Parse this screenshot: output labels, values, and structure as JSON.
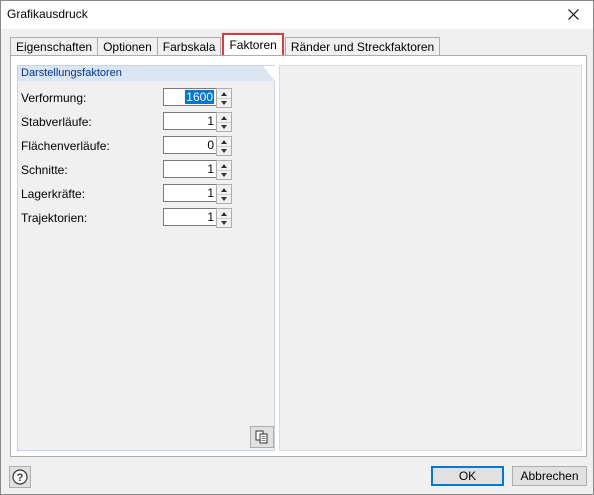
{
  "window": {
    "title": "Grafikausdruck"
  },
  "tabs": [
    {
      "label": "Eigenschaften",
      "active": false
    },
    {
      "label": "Optionen",
      "active": false
    },
    {
      "label": "Farbskala",
      "active": false
    },
    {
      "label": "Faktoren",
      "active": true
    },
    {
      "label": "Ränder und Streckfaktoren",
      "active": false
    }
  ],
  "group": {
    "title": "Darstellungsfaktoren",
    "fields": [
      {
        "label": "Verformung:",
        "value": "1600"
      },
      {
        "label": "Stabverläufe:",
        "value": "1"
      },
      {
        "label": "Flächenverläufe:",
        "value": "0"
      },
      {
        "label": "Schnitte:",
        "value": "1"
      },
      {
        "label": "Lagerkräfte:",
        "value": "1"
      },
      {
        "label": "Trajektorien:",
        "value": "1"
      }
    ]
  },
  "buttons": {
    "ok": "OK",
    "cancel": "Abbrechen"
  },
  "icons": {
    "close": "close-icon",
    "help": "help-icon",
    "copy": "copy-values-icon"
  },
  "colors": {
    "active_tab_border": "#e0383e",
    "group_header": "#dbe6f5",
    "group_header_text": "#003399",
    "selection": "#0078d7"
  }
}
